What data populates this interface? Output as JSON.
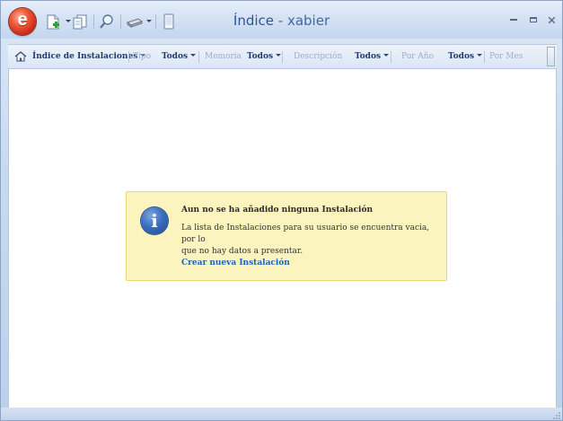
{
  "window": {
    "title_main": "Índice",
    "title_separator": " - ",
    "title_user": "xabier"
  },
  "quick_access": {
    "icons": [
      "new-document-icon",
      "export-icon",
      "search-icon",
      "print-icon",
      "mobile-device-icon"
    ]
  },
  "filterbar": {
    "index_label": "Índice de Instalaciones",
    "tipo_label": "Tipo",
    "tipo_value": "Todos",
    "memoria_label": "Memoria",
    "memoria_value": "Todos",
    "descripcion_label": "Descripción",
    "descripcion_value": "Todos",
    "por_anio_label": "Por Año",
    "por_anio_value": "Todos",
    "por_mes_label": "Por Mes"
  },
  "info": {
    "heading": "Aun no se ha añadido ninguna Instalación",
    "line1": "La lista de Instalaciones para su usuario se encuentra vacia, por lo",
    "line2": "que no hay datos a presentar.",
    "link": "Crear nueva Instalación"
  },
  "colors": {
    "accent": "#2b5797",
    "info_bg": "#fbf4bf",
    "link": "#1e63b4"
  }
}
